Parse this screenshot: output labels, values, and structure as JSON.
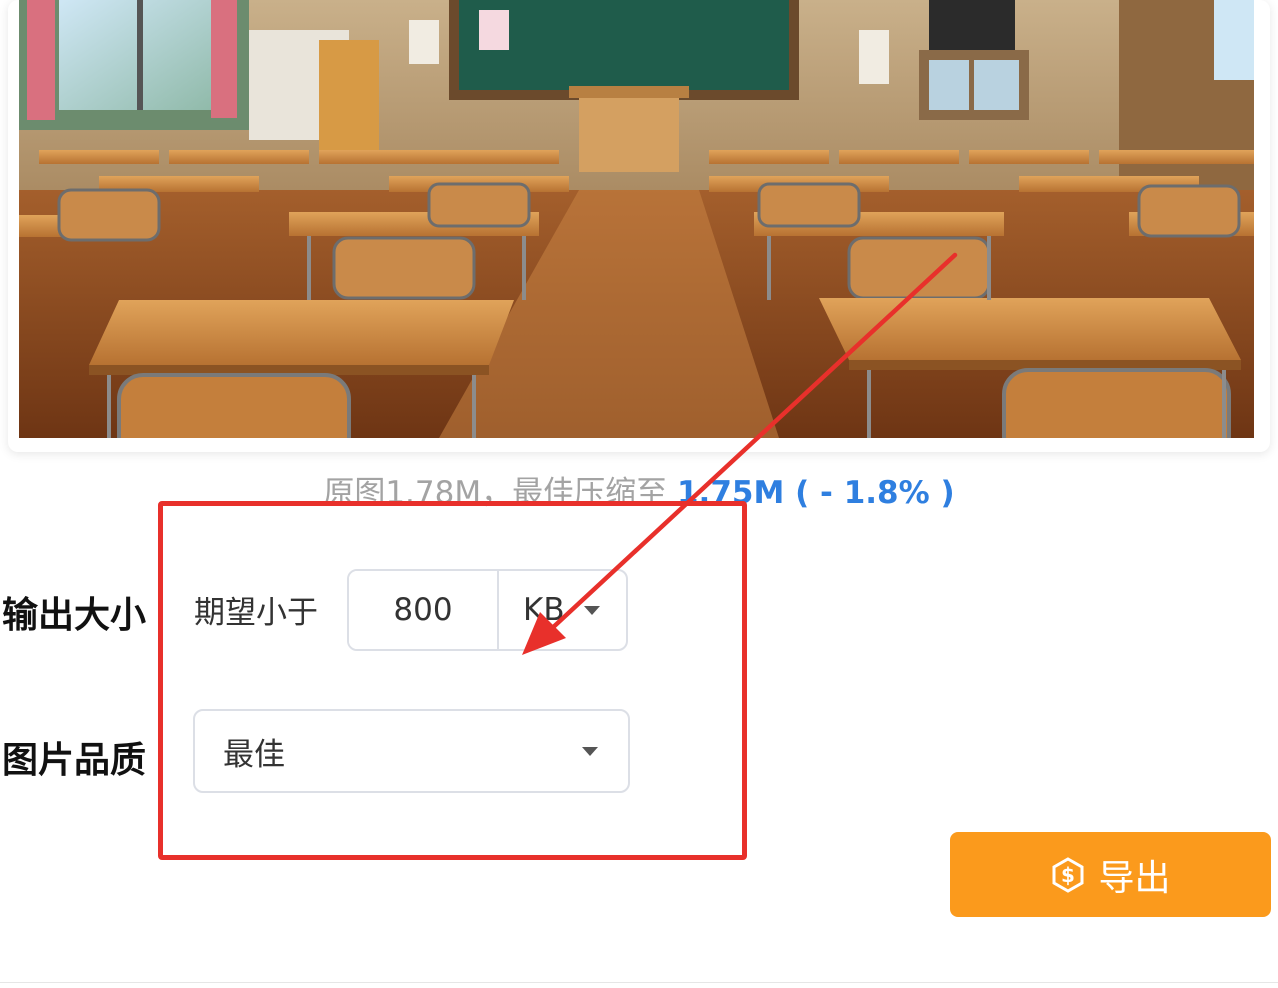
{
  "preview": {
    "image_label": "classroom illustration with wooden desks and chairs",
    "compression": {
      "original_text": "原图1.78M，最佳压缩至",
      "result_text": "1.75M ( - 1.8% )"
    }
  },
  "form": {
    "output_size": {
      "label": "输出大小",
      "hint": "期望小于",
      "value": "800",
      "unit": "KB"
    },
    "quality": {
      "label": "图片品质",
      "selected": "最佳"
    }
  },
  "actions": {
    "export_label": "导出"
  },
  "colors": {
    "accent_blue": "#2f7fe0",
    "export_orange": "#fb9a1c",
    "annotation_red": "#e8302b"
  },
  "icons": {
    "export_icon": "coin-dollar-icon",
    "dropdown_icon": "caret-down-icon"
  }
}
